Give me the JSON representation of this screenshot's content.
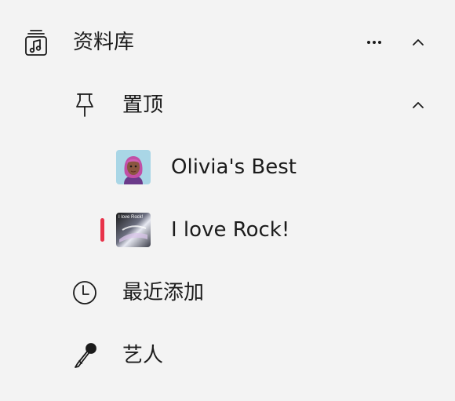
{
  "library": {
    "label": "资料库",
    "icon": "music-library-icon",
    "more_icon": "more-icon",
    "collapse_icon": "chevron-up-icon"
  },
  "pinned": {
    "label": "置顶",
    "icon": "pin-icon",
    "collapse_icon": "chevron-up-icon",
    "items": [
      {
        "label": "Olivia's Best",
        "thumb": "avatar-thumbnail",
        "playing": false
      },
      {
        "label": "I love Rock!",
        "thumb": "playlist-thumbnail",
        "thumb_caption": "I love Rock!",
        "playing": true
      }
    ]
  },
  "recent": {
    "label": "最近添加",
    "icon": "clock-icon"
  },
  "artists": {
    "label": "艺人",
    "icon": "microphone-icon"
  },
  "colors": {
    "background": "#f3f3f3",
    "text": "#1b1b1b",
    "accent": "#e8334a"
  }
}
